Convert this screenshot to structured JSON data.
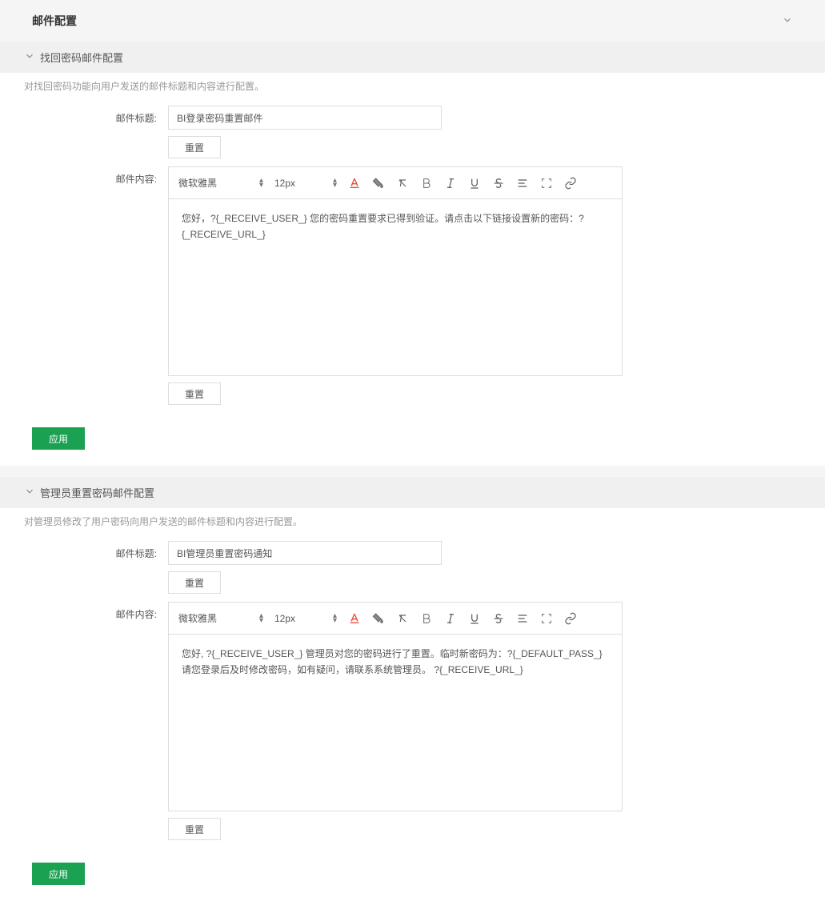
{
  "header": {
    "title": "邮件配置"
  },
  "sections": {
    "password_recovery": {
      "title": "找回密码邮件配置",
      "desc": "对找回密码功能向用户发送的邮件标题和内容进行配置。",
      "title_label": "邮件标题:",
      "title_value": "BI登录密码重置邮件",
      "content_label": "邮件内容:",
      "content_value": "您好，?{_RECEIVE_USER_} 您的密码重置要求已得到验证。请点击以下链接设置新的密码：?{_RECEIVE_URL_}",
      "reset_btn": "重置",
      "apply_btn": "应用"
    },
    "admin_reset": {
      "title": "管理员重置密码邮件配置",
      "desc": "对管理员修改了用户密码向用户发送的邮件标题和内容进行配置。",
      "title_label": "邮件标题:",
      "title_value": "BI管理员重置密码通知",
      "content_label": "邮件内容:",
      "content_value": "您好, ?{_RECEIVE_USER_} 管理员对您的密码进行了重置。临时新密码为：?{_DEFAULT_PASS_} 请您登录后及时修改密码，如有疑问，请联系系统管理员。 ?{_RECEIVE_URL_}",
      "reset_btn": "重置",
      "apply_btn": "应用"
    }
  },
  "editor": {
    "font_family": "微软雅黑",
    "font_size": "12px"
  }
}
